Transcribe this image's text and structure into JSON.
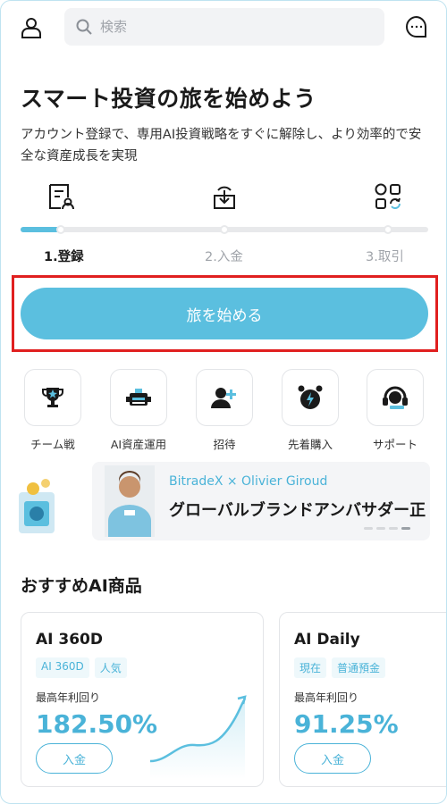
{
  "header": {
    "search_placeholder": "検索"
  },
  "hero": {
    "title": "スマート投資の旅を始めよう",
    "description": "アカウント登録で、専用AI投資戦略をすぐに解除し、より効率的で安全な資産成長を実現"
  },
  "steps": {
    "progress": 0.1,
    "items": [
      {
        "label": "1.登録",
        "active": true
      },
      {
        "label": "2.入金",
        "active": false
      },
      {
        "label": "3.取引",
        "active": false
      }
    ]
  },
  "cta": {
    "label": "旅を始める"
  },
  "quick_menu": [
    {
      "label": "チーム戦",
      "icon": "trophy-icon"
    },
    {
      "label": "AI資産運用",
      "icon": "robot-icon"
    },
    {
      "label": "招待",
      "icon": "add-user-icon"
    },
    {
      "label": "先着購入",
      "icon": "alarm-clock-icon"
    },
    {
      "label": "サポート",
      "icon": "headset-icon"
    }
  ],
  "banner": {
    "subtitle": "BitradeX × Olivier Giroud",
    "title": "グローバルブランドアンバサダー正"
  },
  "products": {
    "section_title": "おすすめAI商品",
    "cards": [
      {
        "name": "AI 360D",
        "tags": [
          "AI 360D",
          "人気"
        ],
        "rate_label": "最高年利回り",
        "rate": "182.50%",
        "button": "入金"
      },
      {
        "name": "AI Daily",
        "tags": [
          "現在",
          "普通預金"
        ],
        "rate_label": "最高年利回り",
        "rate": "91.25%",
        "button": "入金"
      }
    ]
  },
  "colors": {
    "accent": "#5bbfdf",
    "highlight_border": "#e01f1f"
  }
}
